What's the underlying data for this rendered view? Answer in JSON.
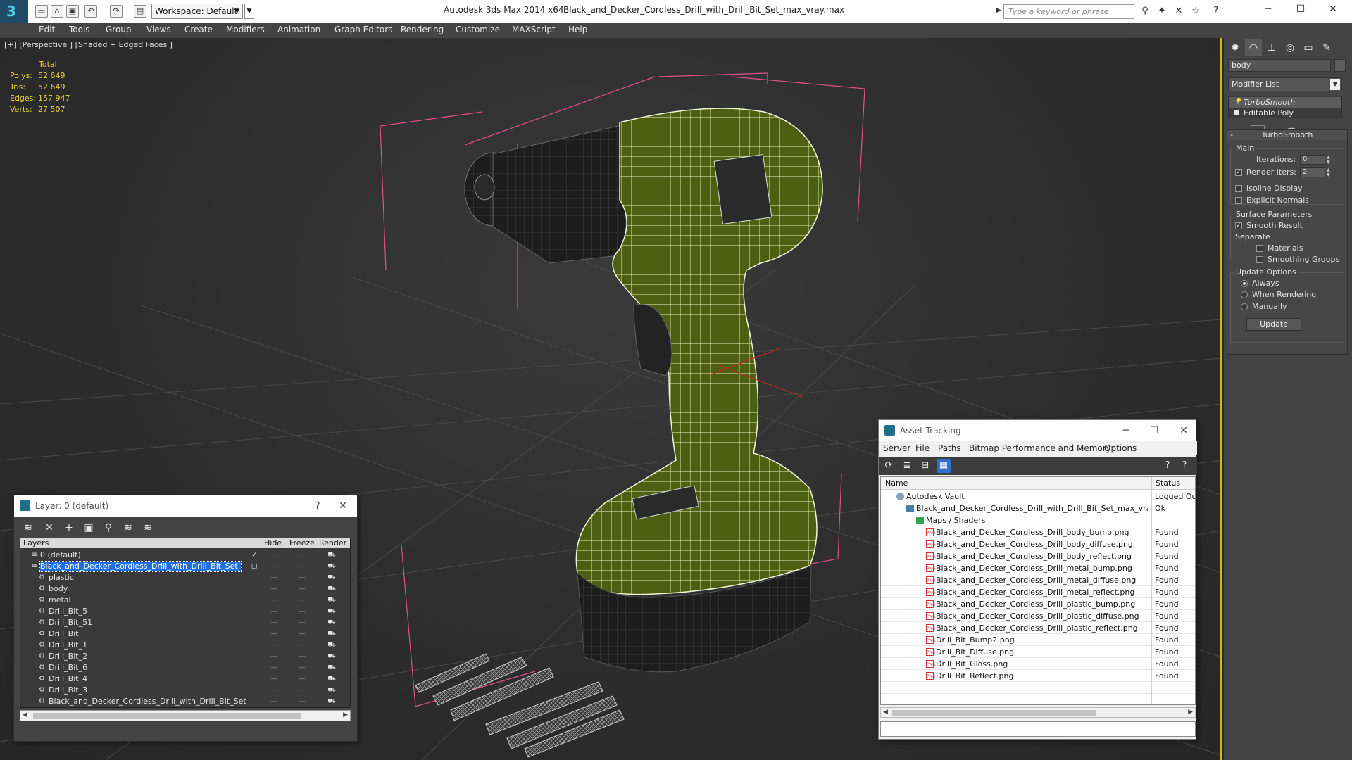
{
  "titlebar": {
    "workspace": "Workspace: Default",
    "app_title": "Autodesk 3ds Max  2014 x64",
    "file_title": "Black_and_Decker_Cordless_Drill_with_Drill_Bit_Set_max_vray.max",
    "search_placeholder": "Type a keyword or phrase"
  },
  "menu": [
    "Edit",
    "Tools",
    "Group",
    "Views",
    "Create",
    "Modifiers",
    "Animation",
    "Graph Editors",
    "Rendering",
    "Customize",
    "MAXScript",
    "Help"
  ],
  "viewport": {
    "label": "[+] [Perspective ] [Shaded + Edged Faces ]",
    "stats": {
      "total_label": "Total",
      "rows": [
        {
          "label": "Polys:",
          "value": "52 649"
        },
        {
          "label": "Tris:",
          "value": "52 649"
        },
        {
          "label": "Edges:",
          "value": "157 947"
        },
        {
          "label": "Verts:",
          "value": "27 507"
        }
      ]
    }
  },
  "command_panel": {
    "object_name": "body",
    "modifier_list": "Modifier List",
    "stack": [
      "TurboSmooth",
      "Editable Poly"
    ],
    "rollout_title": "TurboSmooth",
    "main_label": "Main",
    "iterations_label": "Iterations:",
    "iterations_value": "0",
    "render_iters_label": "Render Iters:",
    "render_iters_value": "2",
    "isoline_label": "Isoline Display",
    "explicit_normals_label": "Explicit Normals",
    "surface_params_label": "Surface Parameters",
    "smooth_result_label": "Smooth Result",
    "separate_label": "Separate",
    "materials_label": "Materials",
    "smoothing_groups_label": "Smoothing Groups",
    "update_options_label": "Update Options",
    "always_label": "Always",
    "when_rendering_label": "When Rendering",
    "manually_label": "Manually",
    "update_button": "Update"
  },
  "layer_dialog": {
    "title": "Layer: 0 (default)",
    "help": "?",
    "columns": {
      "layers": "Layers",
      "hide": "Hide",
      "freeze": "Freeze",
      "render": "Render"
    },
    "rows": [
      {
        "name": "0 (default)",
        "level": 0
      },
      {
        "name": "Black_and_Decker_Cordless_Drill_with_Drill_Bit_Set",
        "level": 0
      },
      {
        "name": "plastic",
        "level": 1
      },
      {
        "name": "body",
        "level": 1
      },
      {
        "name": "metal",
        "level": 1
      },
      {
        "name": "Drill_Bit_5",
        "level": 1
      },
      {
        "name": "Drill_Bit_51",
        "level": 1
      },
      {
        "name": "Drill_Bit",
        "level": 1
      },
      {
        "name": "Drill_Bit_1",
        "level": 1
      },
      {
        "name": "Drill_Bit_2",
        "level": 1
      },
      {
        "name": "Drill_Bit_6",
        "level": 1
      },
      {
        "name": "Drill_Bit_4",
        "level": 1
      },
      {
        "name": "Drill_Bit_3",
        "level": 1
      },
      {
        "name": "Black_and_Decker_Cordless_Drill_with_Drill_Bit_Set",
        "level": 1
      }
    ]
  },
  "asset_dialog": {
    "title": "Asset Tracking",
    "menu": [
      "Server",
      "File",
      "Paths",
      "Bitmap Performance and Memory",
      "Options"
    ],
    "columns": {
      "name": "Name",
      "status": "Status"
    },
    "rows": [
      {
        "name": "Autodesk Vault",
        "status": "Logged Ou",
        "icon": "vault",
        "level": 0
      },
      {
        "name": "Black_and_Decker_Cordless_Drill_with_Drill_Bit_Set_max_vray....",
        "status": "Ok",
        "icon": "max",
        "level": 1
      },
      {
        "name": "Maps / Shaders",
        "status": "",
        "icon": "folder",
        "level": 2
      },
      {
        "name": "Black_and_Decker_Cordless_Drill_body_bump.png",
        "status": "Found",
        "icon": "png",
        "level": 3
      },
      {
        "name": "Black_and_Decker_Cordless_Drill_body_diffuse.png",
        "status": "Found",
        "icon": "png",
        "level": 3
      },
      {
        "name": "Black_and_Decker_Cordless_Drill_body_reflect.png",
        "status": "Found",
        "icon": "png",
        "level": 3
      },
      {
        "name": "Black_and_Decker_Cordless_Drill_metal_bump.png",
        "status": "Found",
        "icon": "png",
        "level": 3
      },
      {
        "name": "Black_and_Decker_Cordless_Drill_metal_diffuse.png",
        "status": "Found",
        "icon": "png",
        "level": 3
      },
      {
        "name": "Black_and_Decker_Cordless_Drill_metal_reflect.png",
        "status": "Found",
        "icon": "png",
        "level": 3
      },
      {
        "name": "Black_and_Decker_Cordless_Drill_plastic_bump.png",
        "status": "Found",
        "icon": "png",
        "level": 3
      },
      {
        "name": "Black_and_Decker_Cordless_Drill_plastic_diffuse.png",
        "status": "Found",
        "icon": "png",
        "level": 3
      },
      {
        "name": "Black_and_Decker_Cordless_Drill_plastic_reflect.png",
        "status": "Found",
        "icon": "png",
        "level": 3
      },
      {
        "name": "Drill_Bit_Bump2.png",
        "status": "Found",
        "icon": "png",
        "level": 3
      },
      {
        "name": "Drill_Bit_Diffuse.png",
        "status": "Found",
        "icon": "png",
        "level": 3
      },
      {
        "name": "Drill_Bit_Gloss.png",
        "status": "Found",
        "icon": "png",
        "level": 3
      },
      {
        "name": "Drill_Bit_Reflect.png",
        "status": "Found",
        "icon": "png",
        "level": 3
      }
    ]
  },
  "colors": {
    "stats_text": "#e7d23c",
    "bbox_pink": "#e0508a",
    "drill_green": "#4f5f12",
    "viewport_border": "#d7b800",
    "selection_blue": "#1e6fe0"
  }
}
